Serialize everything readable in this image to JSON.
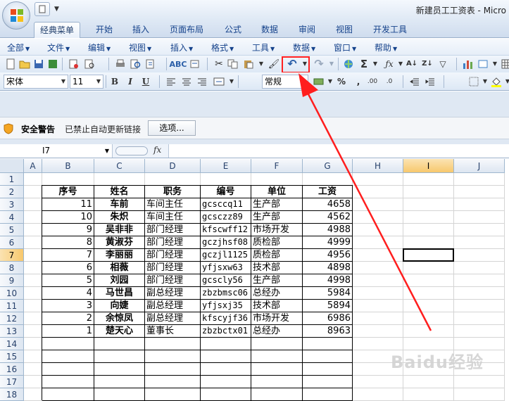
{
  "window": {
    "title": "新建员工工资表 - Micro"
  },
  "ribbon_tabs": [
    {
      "label": "经典菜单",
      "active": true
    },
    {
      "label": "开始"
    },
    {
      "label": "插入"
    },
    {
      "label": "页面布局"
    },
    {
      "label": "公式"
    },
    {
      "label": "数据"
    },
    {
      "label": "审阅"
    },
    {
      "label": "视图"
    },
    {
      "label": "开发工具"
    }
  ],
  "menus": [
    "全部",
    "文件",
    "编辑",
    "视图",
    "插入",
    "格式",
    "工具",
    "数据",
    "窗口",
    "帮助"
  ],
  "format_bar": {
    "font": "宋体",
    "size": "11",
    "number_format": "常规",
    "bold": "B",
    "italic": "I",
    "underline": "U"
  },
  "security": {
    "title": "安全警告",
    "message": "已禁止自动更新链接",
    "options": "选项..."
  },
  "formula_bar": {
    "name_box": "I7",
    "fx": "fx"
  },
  "columns": [
    "A",
    "B",
    "C",
    "D",
    "E",
    "F",
    "G",
    "H",
    "I",
    "J"
  ],
  "selected_column": "I",
  "selected_row": 7,
  "rows": [
    1,
    2,
    3,
    4,
    5,
    6,
    7,
    8,
    9,
    10,
    11,
    12,
    13,
    14,
    15,
    16,
    17,
    18
  ],
  "table": {
    "headers": [
      "序号",
      "姓名",
      "职务",
      "编号",
      "单位",
      "工资"
    ],
    "records": [
      [
        "11",
        "车前",
        "车间主任",
        "gcsccq11",
        "生产部",
        "4658"
      ],
      [
        "10",
        "朱炽",
        "车间主任",
        "gcsczz89",
        "生产部",
        "4562"
      ],
      [
        "9",
        "吴非非",
        "部门经理",
        "kfscwff12",
        "市场开发",
        "4988"
      ],
      [
        "8",
        "黄淑芬",
        "部门经理",
        "gczjhsf08",
        "质检部",
        "4999"
      ],
      [
        "7",
        "李丽丽",
        "部门经理",
        "gczjl1125",
        "质检部",
        "4956"
      ],
      [
        "6",
        "相薇",
        "部门经理",
        "yfjsxw63",
        "技术部",
        "4898"
      ],
      [
        "5",
        "刘园",
        "部门经理",
        "gcscly56",
        "生产部",
        "4998"
      ],
      [
        "4",
        "马世昌",
        "副总经理",
        "zbzbmsc06",
        "总经办",
        "5984"
      ],
      [
        "3",
        "向婕",
        "副总经理",
        "yfjsxj35",
        "技术部",
        "5894"
      ],
      [
        "2",
        "余惊凤",
        "副总经理",
        "kfscyjf36",
        "市场开发",
        "6986"
      ],
      [
        "1",
        "楚天心",
        "董事长",
        "zbzbctx01",
        "总经办",
        "8963"
      ]
    ]
  },
  "watermark": "Baidu经验",
  "colors": {
    "highlight_red": "#ff2020",
    "ribbon_blue": "#15428b"
  }
}
